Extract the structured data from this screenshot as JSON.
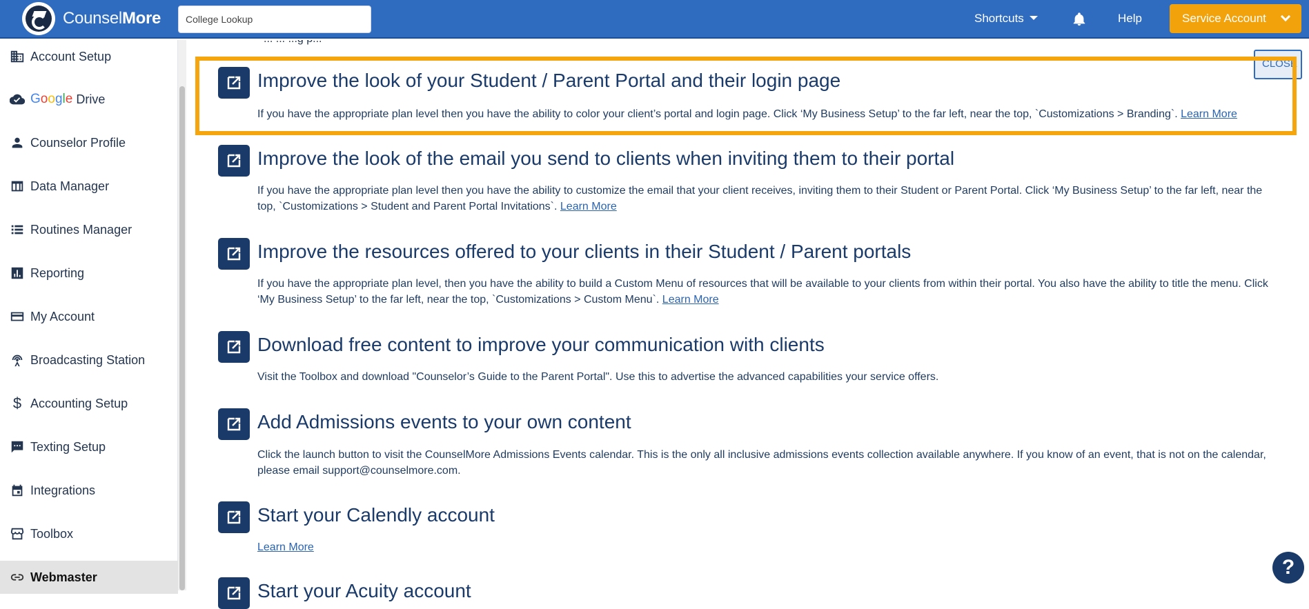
{
  "brand": {
    "name_light": "Counsel",
    "name_bold": "More"
  },
  "search": {
    "placeholder": "College Lookup"
  },
  "header": {
    "shortcuts_label": "Shortcuts",
    "help_label": "Help",
    "account_label": "Service Account"
  },
  "sidebar": {
    "items": [
      {
        "label": "Account Setup",
        "icon": "building-icon"
      },
      {
        "label": "Drive",
        "icon": "cloud-check-icon"
      },
      {
        "label": "Counselor Profile",
        "icon": "person-icon"
      },
      {
        "label": "Data Manager",
        "icon": "table-icon"
      },
      {
        "label": "Routines Manager",
        "icon": "list-icon"
      },
      {
        "label": "Reporting",
        "icon": "bar-chart-icon"
      },
      {
        "label": "My Account",
        "icon": "card-icon"
      },
      {
        "label": "Broadcasting Station",
        "icon": "antenna-icon"
      },
      {
        "label": "Accounting Setup",
        "icon": "dollar-icon"
      },
      {
        "label": "Texting Setup",
        "icon": "chat-icon"
      },
      {
        "label": "Integrations",
        "icon": "calendar-icon"
      },
      {
        "label": "Toolbox",
        "icon": "store-icon"
      },
      {
        "label": "Webmaster",
        "icon": "link-icon"
      }
    ],
    "google_text": [
      "G",
      "o",
      "o",
      "g",
      "l",
      "e"
    ]
  },
  "main": {
    "peek_text": "... ... ...g p...",
    "close_label": "CLOSE",
    "learn_more": "Learn More",
    "tasks": [
      {
        "title": "Improve the look of your Student / Parent Portal and their login page",
        "desc": "If you have the appropriate plan level then you have the ability to color your client’s portal and login page. Click ‘My Business Setup’ to the far left, near the top, `Customizations > Branding`."
      },
      {
        "title": "Improve the look of the email you send to clients when inviting them to their portal",
        "desc": "If you have the appropriate plan level then you have the ability to customize the email that your client receives, inviting them to their Student or Parent Portal. Click ‘My Business Setup’ to the far left, near the top, `Customizations > Student and Parent Portal Invitations`."
      },
      {
        "title": "Improve the resources offered to your clients in their Student / Parent portals",
        "desc": "If you have the appropriate plan level, then you have the ability to build a Custom Menu of resources that will be available to your clients from within their portal. You also have the ability to title the menu. Click ‘My Business Setup’ to the far left, near the top, `Customizations > Custom Menu`."
      },
      {
        "title": "Download free content to improve your communication with clients",
        "desc": "Visit the Toolbox and download \"Counselor’s Guide to the Parent Portal\". Use this to advertise the advanced capabilities your service offers."
      },
      {
        "title": "Add Admissions events to your own content",
        "desc": "Click the launch button to visit the CounselMore Admissions Events calendar. This is the only all inclusive admissions events collection available anywhere. If you know of an event, that is not on the calendar, please email support@counselmore.com."
      },
      {
        "title": "Start your Calendly account",
        "desc": ""
      },
      {
        "title": "Start your Acuity account",
        "desc": ""
      }
    ],
    "help_fab": "?"
  },
  "colors": {
    "accent": "#2f6cc0",
    "highlight": "#f5a50d",
    "dark": "#1a3a6a"
  }
}
